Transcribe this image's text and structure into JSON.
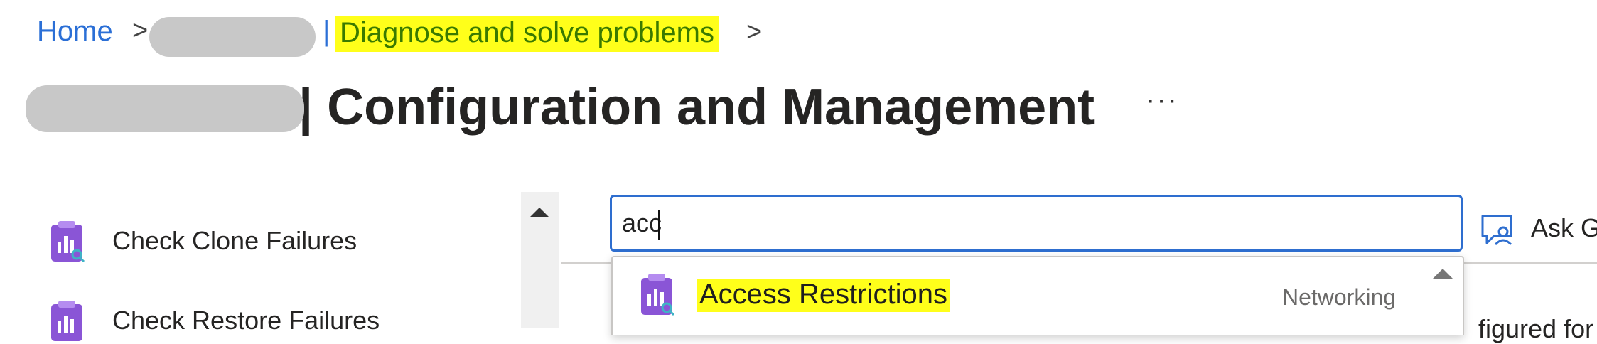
{
  "breadcrumb": {
    "home": "Home",
    "separator": ">",
    "pipe": "|",
    "current": "Diagnose and solve problems",
    "trailing_separator": ">"
  },
  "page": {
    "title_suffix": "| Configuration and Management",
    "more_label": "···"
  },
  "nav": {
    "items": [
      {
        "label": "Check Clone Failures",
        "icon": "diagnostic-clipboard-icon"
      },
      {
        "label": "Check Restore Failures",
        "icon": "diagnostic-clipboard-icon"
      }
    ]
  },
  "search": {
    "value": "acc"
  },
  "dropdown": {
    "items": [
      {
        "label": "Access Restrictions",
        "category": "Networking",
        "icon": "diagnostic-clipboard-icon"
      }
    ]
  },
  "ask": {
    "label": "Ask G",
    "icon": "chat-person-icon"
  },
  "content": {
    "partial_text": "figured for t"
  },
  "colors": {
    "link": "#2b6fd6",
    "highlight": "#ffff1a",
    "focus_border": "#2e6ecf",
    "icon_purple": "#8a55d6"
  }
}
